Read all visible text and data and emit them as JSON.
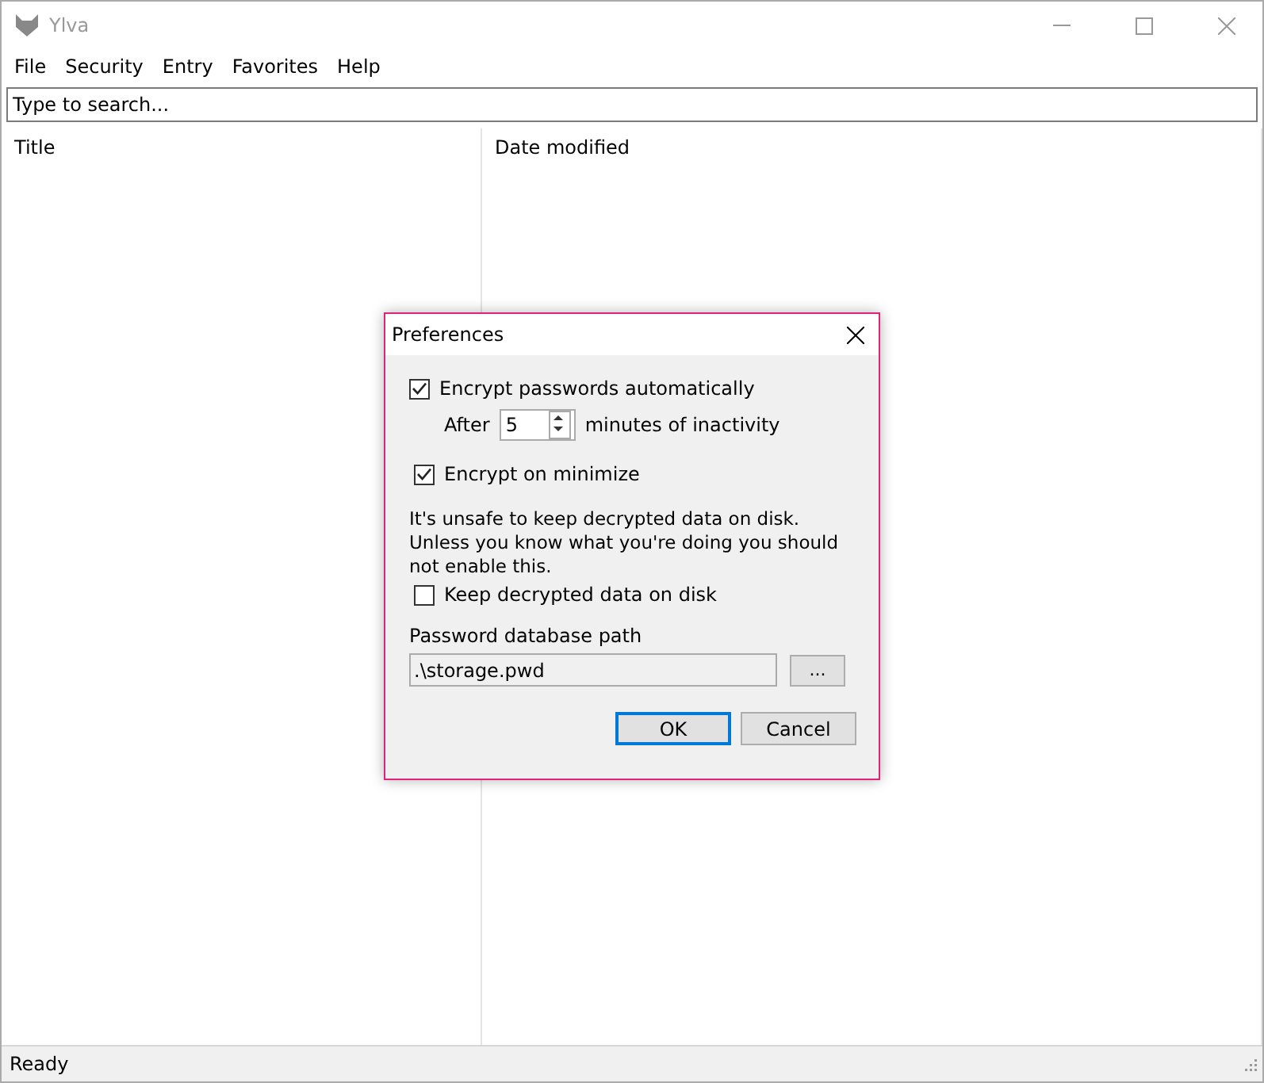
{
  "window": {
    "title": "Ylva"
  },
  "menu": [
    "File",
    "Security",
    "Entry",
    "Favorites",
    "Help"
  ],
  "search": {
    "placeholder": "Type to search..."
  },
  "table": {
    "columns": [
      "Title",
      "Date modified"
    ]
  },
  "status_bar": "Ready",
  "dialog": {
    "title": "Preferences",
    "encrypt_auto": {
      "label": "Encrypt passwords automatically",
      "checked": true
    },
    "after_label": "After",
    "minutes": "5",
    "minutes_label": "minutes of inactivity",
    "encrypt_minimize": {
      "label": "Encrypt on minimize",
      "checked": true
    },
    "warning": "It's unsafe to keep decrypted data on disk. Unless you know what you're doing you should not enable this.",
    "keep_decrypted": {
      "label": "Keep decrypted data on disk",
      "checked": false
    },
    "path_label": "Password database path",
    "path": ".\\storage.pwd",
    "browse": "...",
    "buttons": [
      {
        "label": "OK",
        "default": true
      },
      {
        "label": "Cancel",
        "default": false
      }
    ]
  }
}
